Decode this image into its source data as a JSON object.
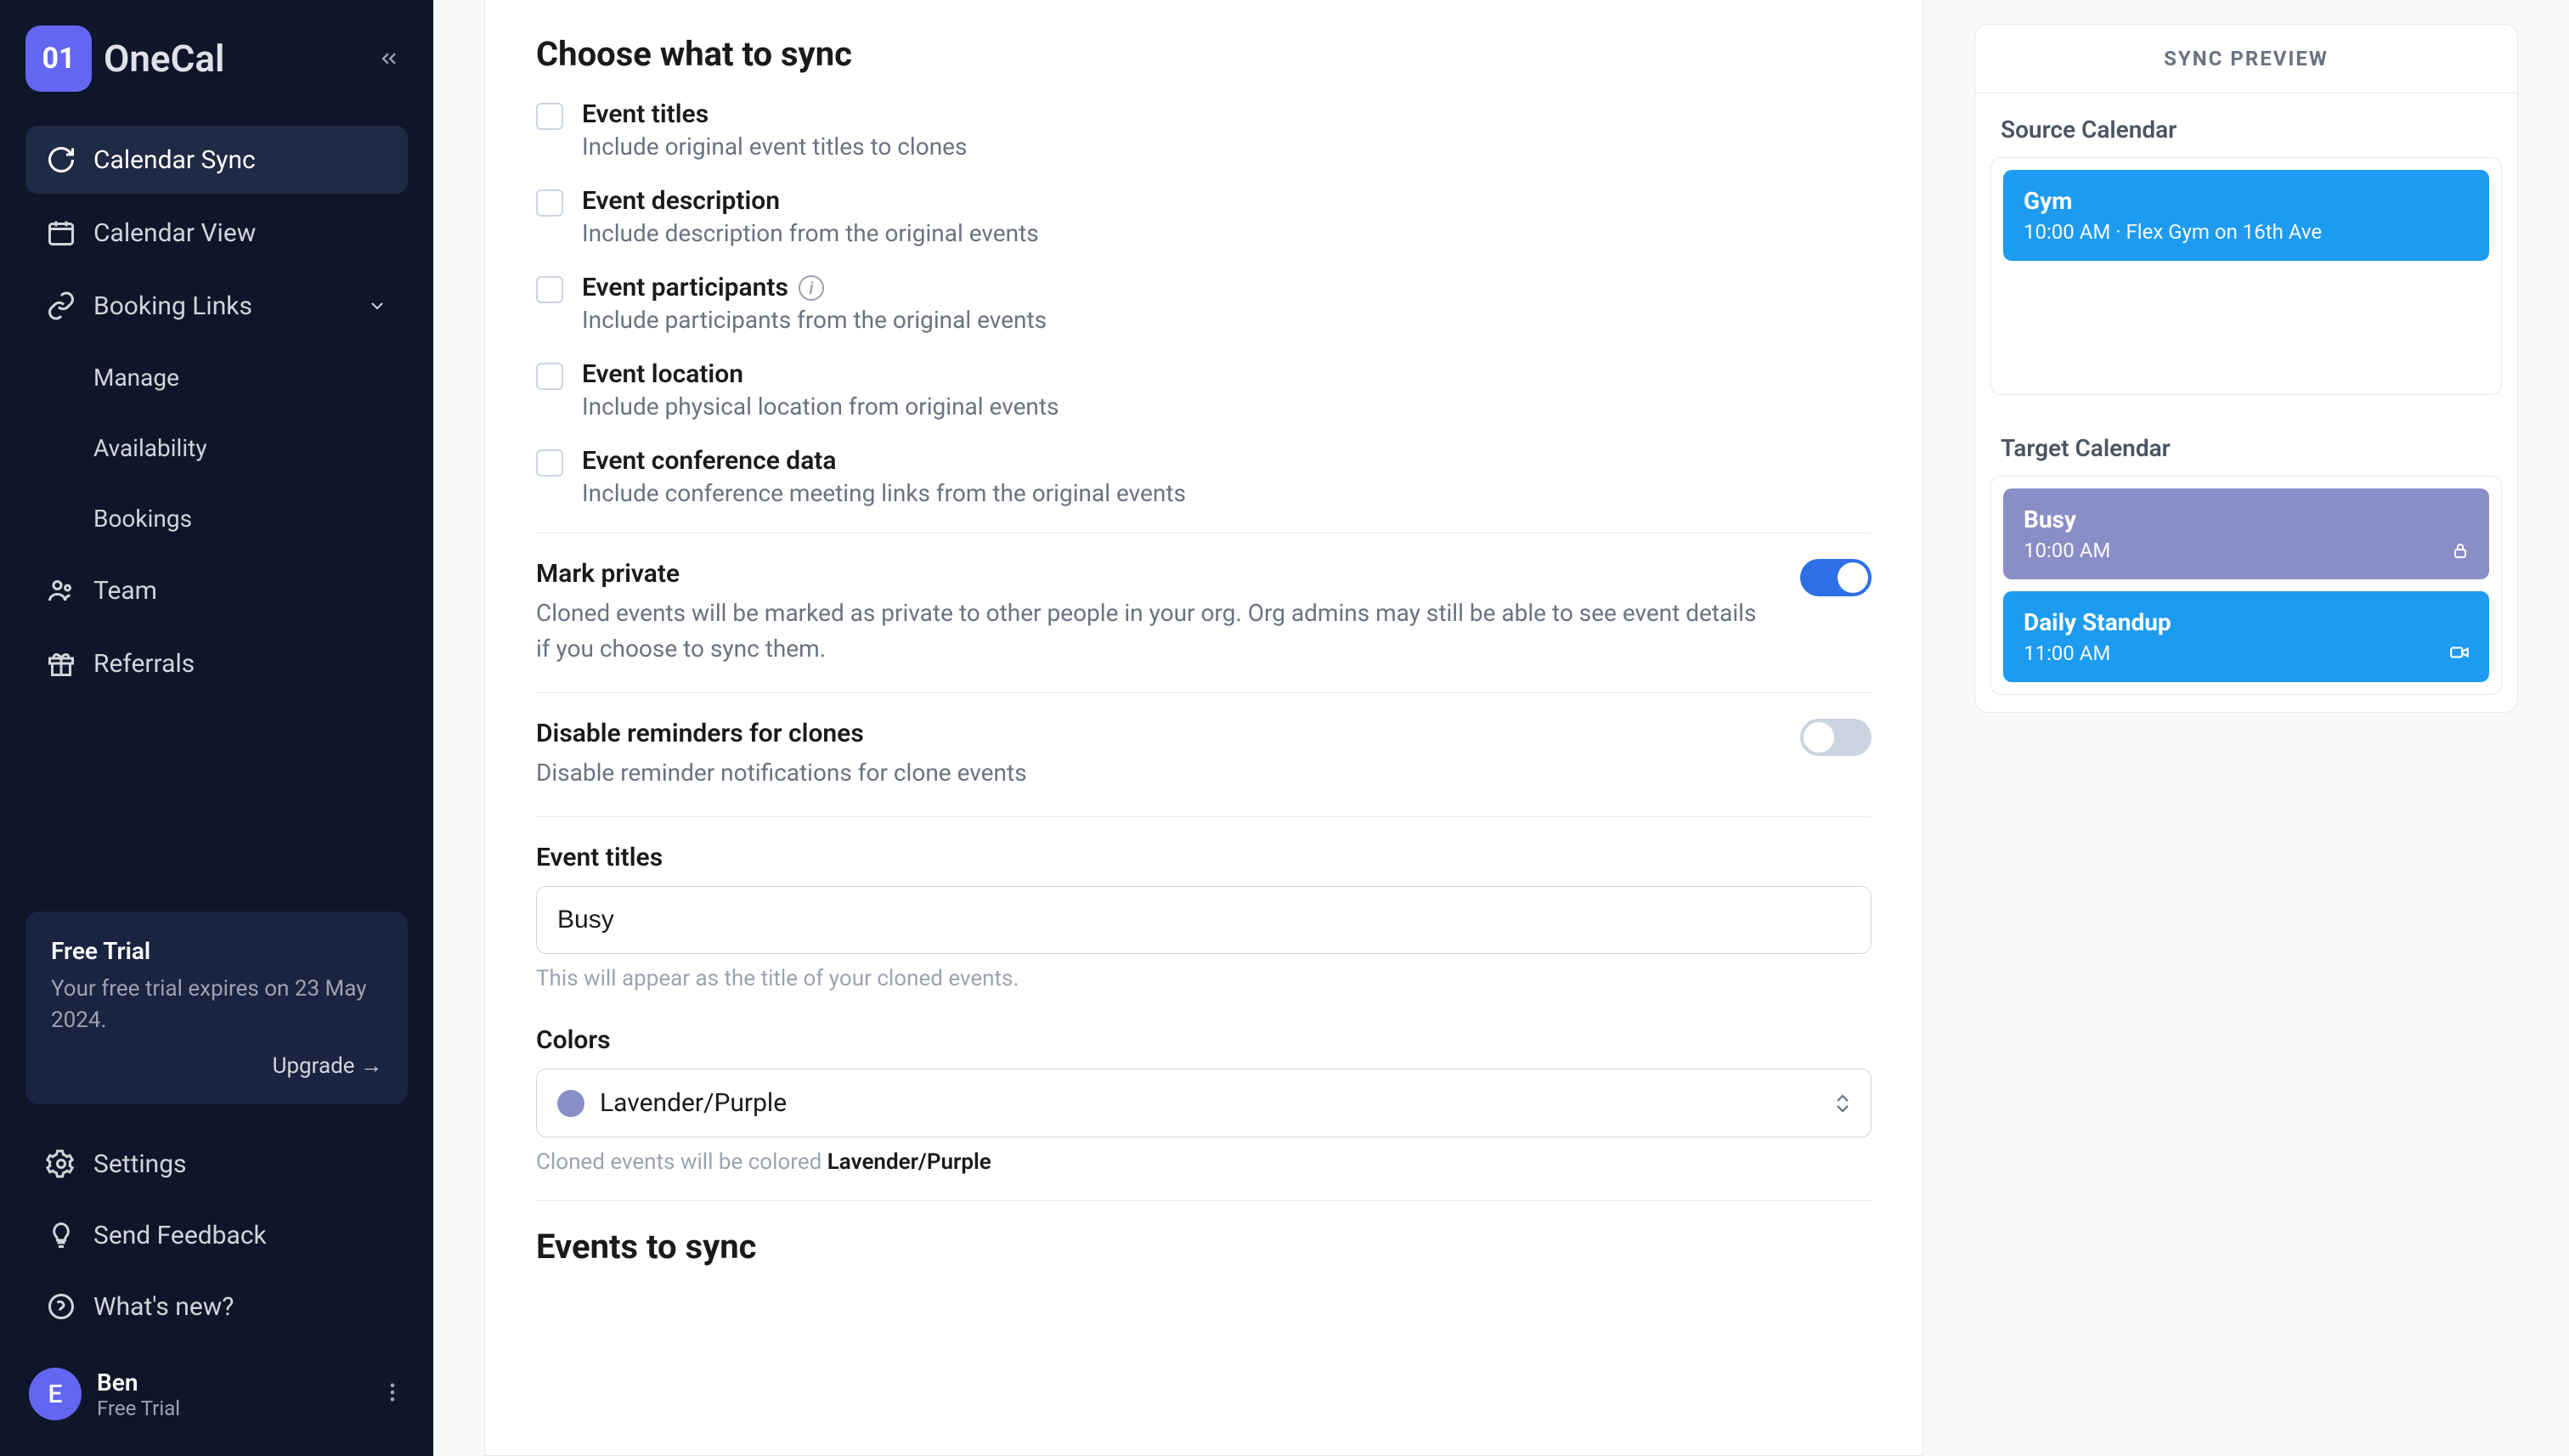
{
  "brand": {
    "mark": "01",
    "name": "OneCal"
  },
  "nav": {
    "calendar_sync": "Calendar Sync",
    "calendar_view": "Calendar View",
    "booking_links": "Booking Links",
    "manage": "Manage",
    "availability": "Availability",
    "bookings": "Bookings",
    "team": "Team",
    "referrals": "Referrals"
  },
  "trial": {
    "title": "Free Trial",
    "text": "Your free trial expires on 23 May 2024.",
    "upgrade": "Upgrade →"
  },
  "bottom": {
    "settings": "Settings",
    "send_feedback": "Send Feedback",
    "whats_new": "What's new?"
  },
  "user": {
    "initial": "E",
    "name": "Ben",
    "plan": "Free Trial"
  },
  "form": {
    "section_title": "Choose what to sync",
    "checks": [
      {
        "title": "Event titles",
        "sub": "Include original event titles to clones"
      },
      {
        "title": "Event description",
        "sub": "Include description from the original events"
      },
      {
        "title": "Event participants",
        "sub": "Include participants from the original events",
        "info": true
      },
      {
        "title": "Event location",
        "sub": "Include physical location from original events"
      },
      {
        "title": "Event conference data",
        "sub": "Include conference meeting links from the original events"
      }
    ],
    "mark_private": {
      "title": "Mark private",
      "sub": "Cloned events will be marked as private to other people in your org. Org admins may still be able to see event details if you choose to sync them."
    },
    "disable_reminders": {
      "title": "Disable reminders for clones",
      "sub": "Disable reminder notifications for clone events"
    },
    "event_titles_field": {
      "label": "Event titles",
      "value": "Busy",
      "help": "This will appear as the title of your cloned events."
    },
    "colors_field": {
      "label": "Colors",
      "value": "Lavender/Purple",
      "help_prefix": "Cloned events will be colored ",
      "help_color": "Lavender/Purple"
    },
    "events_to_sync": "Events to sync"
  },
  "preview": {
    "header": "SYNC PREVIEW",
    "source": "Source Calendar",
    "target": "Target Calendar",
    "source_events": [
      {
        "title": "Gym",
        "sub": "10:00 AM · Flex Gym on 16th Ave",
        "color": "blue"
      }
    ],
    "target_events": [
      {
        "title": "Busy",
        "sub": "10:00 AM",
        "color": "purple",
        "icon": "lock"
      },
      {
        "title": "Daily Standup",
        "sub": "11:00 AM",
        "color": "blue",
        "icon": "video"
      }
    ]
  }
}
